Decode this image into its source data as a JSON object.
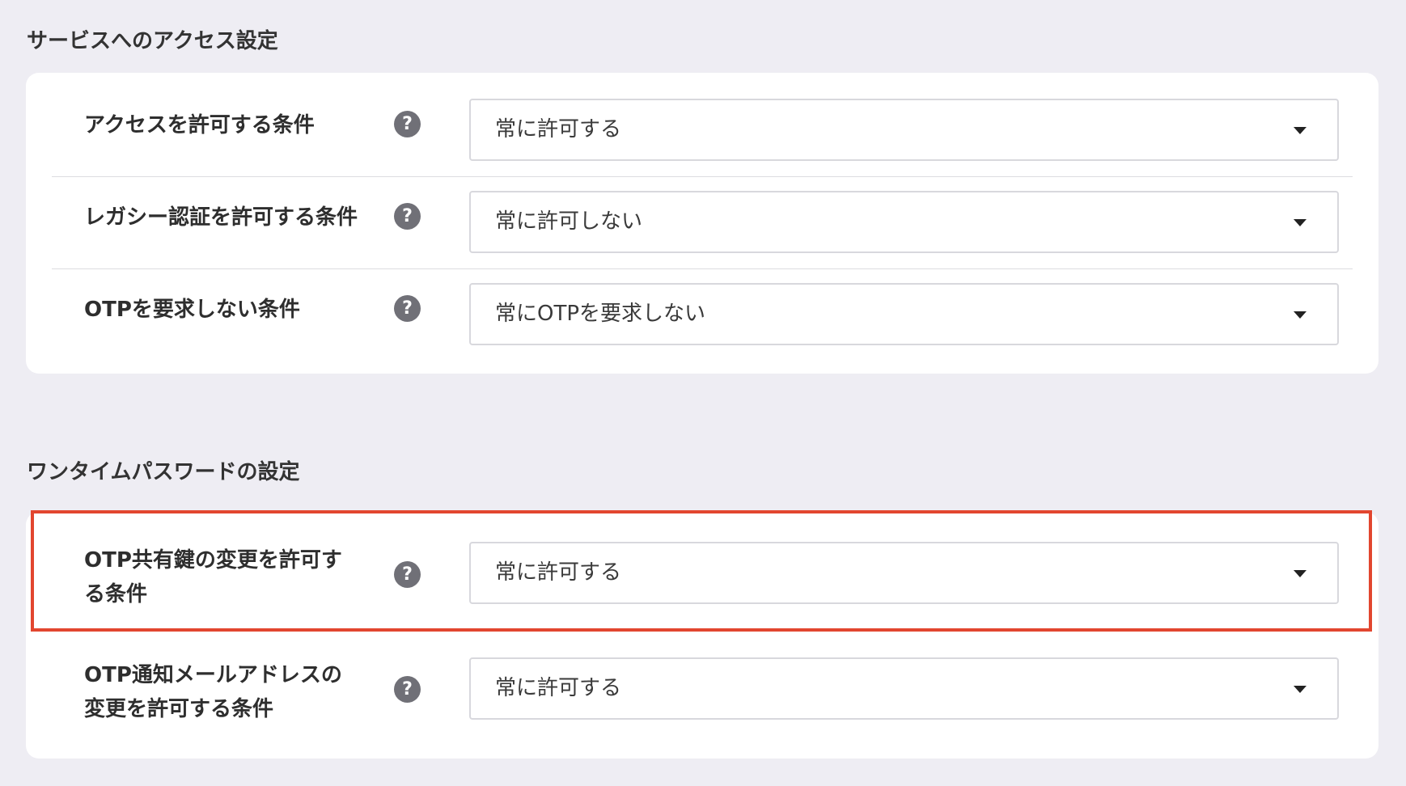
{
  "sections": [
    {
      "title": "サービスへのアクセス設定",
      "rows": [
        {
          "label": "アクセスを許可する条件",
          "help": "?",
          "value": "常に許可する"
        },
        {
          "label": "レガシー認証を許可する条件",
          "help": "?",
          "value": "常に許可しない"
        },
        {
          "label": "OTPを要求しない条件",
          "help": "?",
          "value": "常にOTPを要求しない"
        }
      ]
    },
    {
      "title": "ワンタイムパスワードの設定",
      "rows": [
        {
          "label_line1": "OTP共有鍵の変更を許可す",
          "label_line2": "る条件",
          "help": "?",
          "value": "常に許可する"
        },
        {
          "label_line1": "OTP通知メールアドレスの",
          "label_line2": "変更を許可する条件",
          "help": "?",
          "value": "常に許可する"
        }
      ]
    }
  ],
  "highlight_color": "#e2462f",
  "icons": {
    "help": "question-circle-icon",
    "dropdown": "caret-down-icon"
  }
}
